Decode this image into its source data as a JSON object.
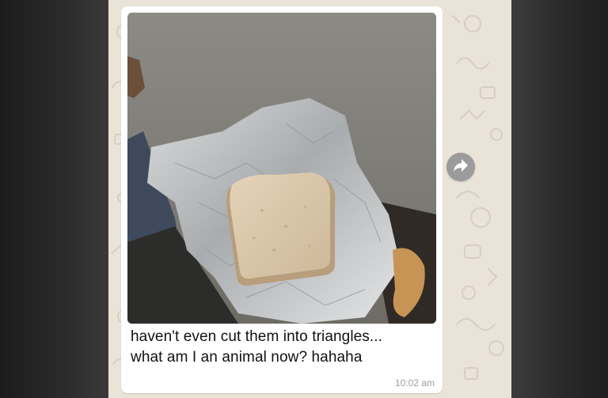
{
  "message": {
    "caption_lines": [
      "haven't even cut them into triangles...",
      "what am I an animal now? hahaha"
    ],
    "timestamp": "10:02 am"
  },
  "icons": {
    "forward": "forward-arrow-icon"
  },
  "colors": {
    "chat_background": "#e9e3d8",
    "bubble": "#ffffff",
    "forward_button": "#9b9b9b",
    "timestamp_text": "#9aa0a6"
  }
}
